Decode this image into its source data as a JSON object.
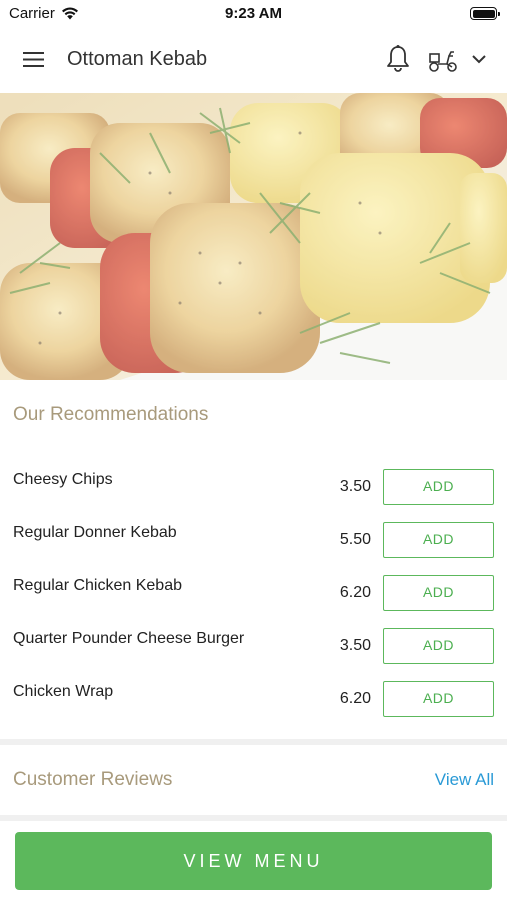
{
  "status_bar": {
    "carrier": "Carrier",
    "time": "9:23 AM",
    "wifi_icon": "wifi-icon",
    "battery_icon": "battery-icon"
  },
  "header": {
    "title": "Ottoman Kebab",
    "menu_icon": "hamburger-menu-icon",
    "notification_icon": "bell-icon",
    "delivery_icon": "scooter-icon",
    "dropdown_icon": "chevron-down-icon"
  },
  "hero": {
    "image": "kebab-skewers-photo"
  },
  "recommendations": {
    "title": "Our Recommendations",
    "add_label": "ADD",
    "items": [
      {
        "name": "Cheesy Chips",
        "price": "3.50"
      },
      {
        "name": "Regular Donner Kebab",
        "price": "5.50"
      },
      {
        "name": "Regular Chicken Kebab",
        "price": "6.20"
      },
      {
        "name": "Quarter Pounder Cheese Burger",
        "price": "3.50"
      },
      {
        "name": "Chicken Wrap",
        "price": "6.20"
      }
    ]
  },
  "reviews": {
    "title": "Customer Reviews",
    "view_all": "View All"
  },
  "footer": {
    "view_menu": "VIEW MENU"
  },
  "colors": {
    "accent_green": "#5cb85c",
    "section_title": "#a89a7c",
    "link_blue": "#2a9ad6"
  }
}
